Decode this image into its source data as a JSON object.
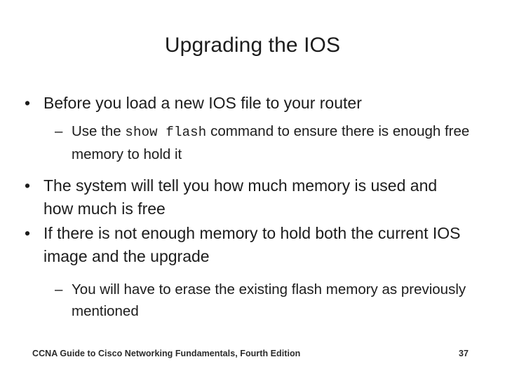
{
  "slide": {
    "title": "Upgrading the IOS",
    "bullets": [
      {
        "level": 1,
        "marker": "•",
        "text": "Before you load a new IOS file to your router"
      },
      {
        "level": 2,
        "marker": "–",
        "text_before_code": "Use the ",
        "code": "show flash",
        "text_after_code": " command to ensure there is enough free memory to hold it"
      },
      {
        "level": 1,
        "marker": "•",
        "text": "The system will tell you how much memory is used and how much is free"
      },
      {
        "level": 1,
        "marker": "•",
        "text": "If there is not enough memory to hold both the current IOS image and the upgrade"
      },
      {
        "level": 2,
        "marker": "–",
        "text": "You will have to erase the existing flash memory as previously mentioned"
      }
    ]
  },
  "footer": {
    "citation": "CCNA Guide to Cisco Networking Fundamentals, Fourth Edition",
    "page_number": "37"
  },
  "colors": {
    "background": "#ffffff",
    "text": "#1c1c1c",
    "footer_text": "#2b2b2b"
  }
}
